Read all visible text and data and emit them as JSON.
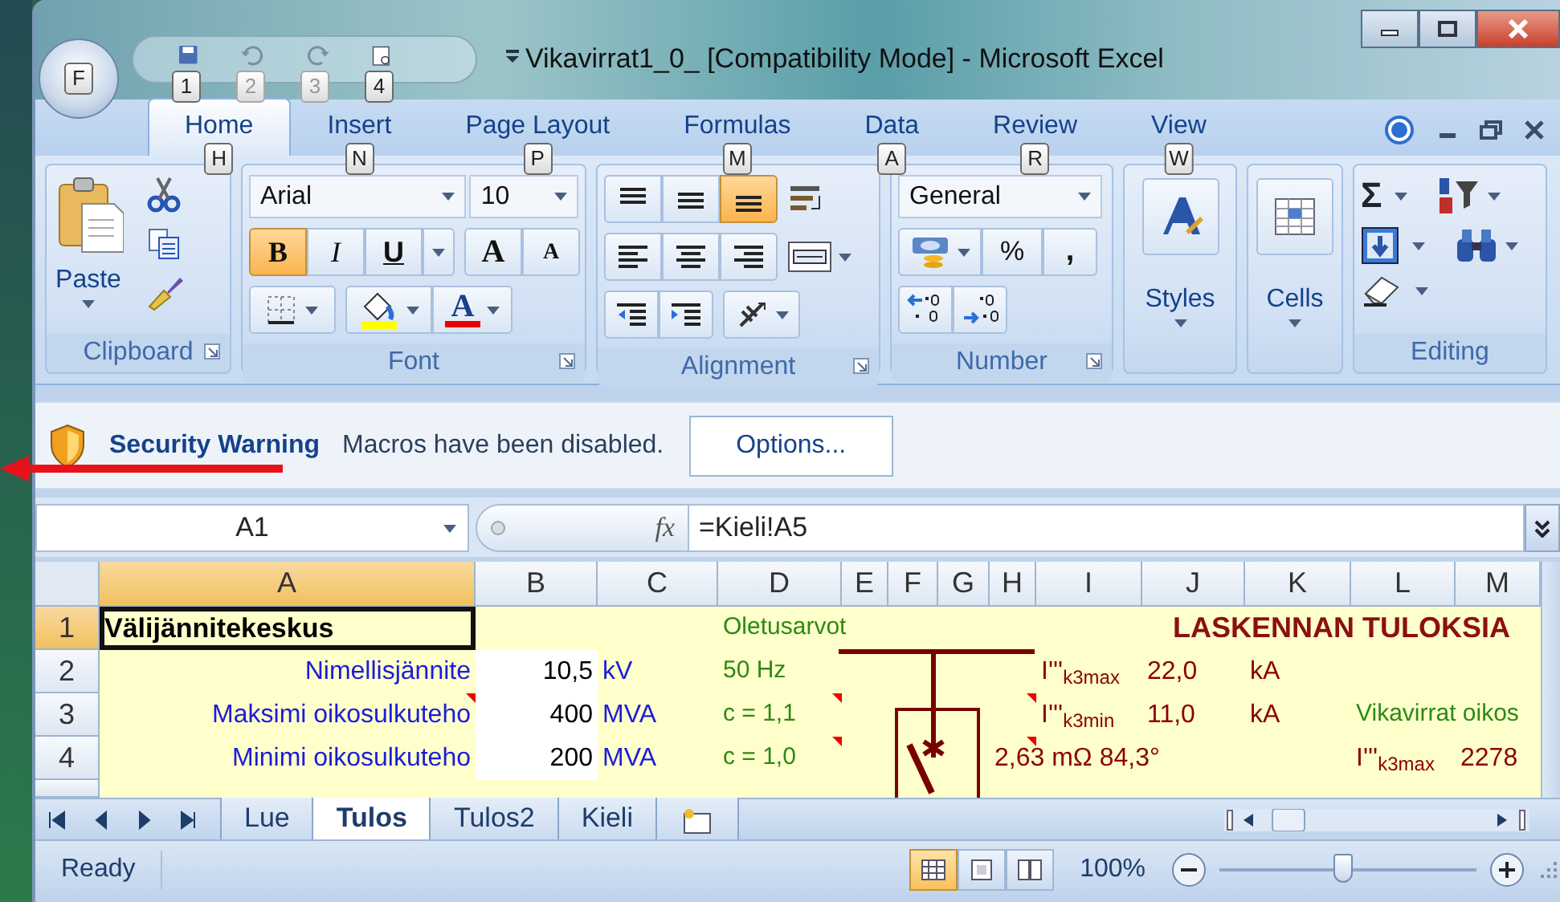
{
  "title_bar": {
    "title": "Vikavirrat1_0_  [Compatibility Mode] - Microsoft Excel",
    "office_key": "F",
    "quick_access": [
      {
        "key": "1",
        "disabled": false
      },
      {
        "key": "2",
        "disabled": true
      },
      {
        "key": "3",
        "disabled": true
      },
      {
        "key": "4",
        "disabled": false
      }
    ]
  },
  "ribbon_tabs": [
    {
      "label": "Home",
      "key": "H",
      "selected": true
    },
    {
      "label": "Insert",
      "key": "N",
      "selected": false
    },
    {
      "label": "Page Layout",
      "key": "P",
      "selected": false
    },
    {
      "label": "Formulas",
      "key": "M",
      "selected": false
    },
    {
      "label": "Data",
      "key": "A",
      "selected": false
    },
    {
      "label": "Review",
      "key": "R",
      "selected": false
    },
    {
      "label": "View",
      "key": "W",
      "selected": false
    }
  ],
  "ribbon": {
    "clipboard": {
      "label": "Clipboard",
      "paste": "Paste"
    },
    "font": {
      "label": "Font",
      "font_name": "Arial",
      "font_size": "10",
      "bold": {
        "text": "B",
        "selected": true
      },
      "italic": {
        "text": "I",
        "selected": false
      },
      "underline": {
        "text": "U",
        "selected": false
      },
      "grow": "A",
      "shrink": "A",
      "font_color": "A"
    },
    "alignment": {
      "label": "Alignment",
      "vertical": [
        {
          "selected": false
        },
        {
          "selected": false
        },
        {
          "selected": true
        }
      ]
    },
    "number": {
      "label": "Number",
      "format": "General",
      "percent": "%",
      "comma": ","
    },
    "styles": {
      "label": "Styles"
    },
    "cells": {
      "label": "Cells"
    },
    "editing": {
      "label": "Editing",
      "sum": "Σ"
    }
  },
  "security_bar": {
    "title": "Security Warning",
    "message": "Macros have been disabled.",
    "button": "Options..."
  },
  "formula_bar": {
    "name_box": "A1",
    "fx": "fx",
    "formula": "=Kieli!A5"
  },
  "sheet": {
    "columns": [
      {
        "label": "A",
        "selected": true
      },
      {
        "label": "B",
        "selected": false
      },
      {
        "label": "C",
        "selected": false
      },
      {
        "label": "D",
        "selected": false
      },
      {
        "label": "E",
        "selected": false
      },
      {
        "label": "F",
        "selected": false
      },
      {
        "label": "G",
        "selected": false
      },
      {
        "label": "H",
        "selected": false
      },
      {
        "label": "I",
        "selected": false
      },
      {
        "label": "J",
        "selected": false
      },
      {
        "label": "K",
        "selected": false
      },
      {
        "label": "L",
        "selected": false
      },
      {
        "label": "M",
        "selected": false
      }
    ],
    "rows": [
      {
        "label": "1",
        "selected": true,
        "cells": [
          {
            "kind": "title",
            "text": "Välijännitekeskus",
            "active": true
          },
          {
            "kind": "blank"
          },
          {
            "kind": "blank"
          },
          {
            "kind": "default",
            "text": "Oletusarvot"
          },
          {
            "kind": "blank"
          },
          {
            "kind": "blank"
          },
          {
            "kind": "blank"
          },
          {
            "kind": "blank"
          },
          {
            "kind": "blank"
          },
          {
            "kind": "result_heading",
            "text": "LASKENNAN TULOKSIA"
          },
          {
            "kind": "blank"
          },
          {
            "kind": "blank"
          },
          {
            "kind": "blank"
          }
        ]
      },
      {
        "label": "2",
        "selected": false,
        "cells": [
          {
            "kind": "label",
            "text": "Nimellisjännite"
          },
          {
            "kind": "input",
            "text": "10,5"
          },
          {
            "kind": "unit",
            "text": "kV"
          },
          {
            "kind": "default",
            "text": "50 Hz"
          },
          {
            "kind": "blank"
          },
          {
            "kind": "blank"
          },
          {
            "kind": "blank"
          },
          {
            "kind": "blank"
          },
          {
            "kind": "result",
            "text": "I'''$_{k3max}$"
          },
          {
            "kind": "result",
            "text": "22,0"
          },
          {
            "kind": "result",
            "text": "kA"
          },
          {
            "kind": "blank"
          },
          {
            "kind": "blank"
          }
        ]
      },
      {
        "label": "3",
        "selected": false,
        "cells": [
          {
            "kind": "label",
            "text": "Maksimi oikosulkuteho",
            "comment": true
          },
          {
            "kind": "input",
            "text": "400"
          },
          {
            "kind": "unit",
            "text": "MVA"
          },
          {
            "kind": "default",
            "text": "c = 1,1",
            "comment": true
          },
          {
            "kind": "blank"
          },
          {
            "kind": "blank"
          },
          {
            "kind": "blank"
          },
          {
            "kind": "blank",
            "comment": true
          },
          {
            "kind": "result",
            "text": "I'''$_{k3min}$"
          },
          {
            "kind": "result",
            "text": "11,0"
          },
          {
            "kind": "result",
            "text": "kA"
          },
          {
            "kind": "note",
            "text": "Vikavirrat oikos"
          },
          {
            "kind": "blank"
          }
        ]
      },
      {
        "label": "4",
        "selected": false,
        "cells": [
          {
            "kind": "label",
            "text": "Minimi oikosulkuteho"
          },
          {
            "kind": "input",
            "text": "200"
          },
          {
            "kind": "unit",
            "text": "MVA"
          },
          {
            "kind": "default",
            "text": "c = 1,0",
            "comment": true
          },
          {
            "kind": "blank"
          },
          {
            "kind": "blank"
          },
          {
            "kind": "blank"
          },
          {
            "kind": "result",
            "text": "2,63 mΩ 84,3°",
            "comment": true
          },
          {
            "kind": "blank"
          },
          {
            "kind": "blank"
          },
          {
            "kind": "blank"
          },
          {
            "kind": "result",
            "text": "I'''$_{k3max}$"
          },
          {
            "kind": "result",
            "text": "2278"
          }
        ]
      }
    ]
  },
  "sheet_tabs": [
    {
      "label": "Lue",
      "selected": false
    },
    {
      "label": "Tulos",
      "selected": true
    },
    {
      "label": "Tulos2",
      "selected": false
    },
    {
      "label": "Kieli",
      "selected": false
    }
  ],
  "status_bar": {
    "status": "Ready",
    "views": [
      {
        "selected": true
      },
      {
        "selected": false
      },
      {
        "selected": false
      }
    ],
    "zoom": "100%",
    "zoom_slider": {
      "level": 0.48
    }
  }
}
